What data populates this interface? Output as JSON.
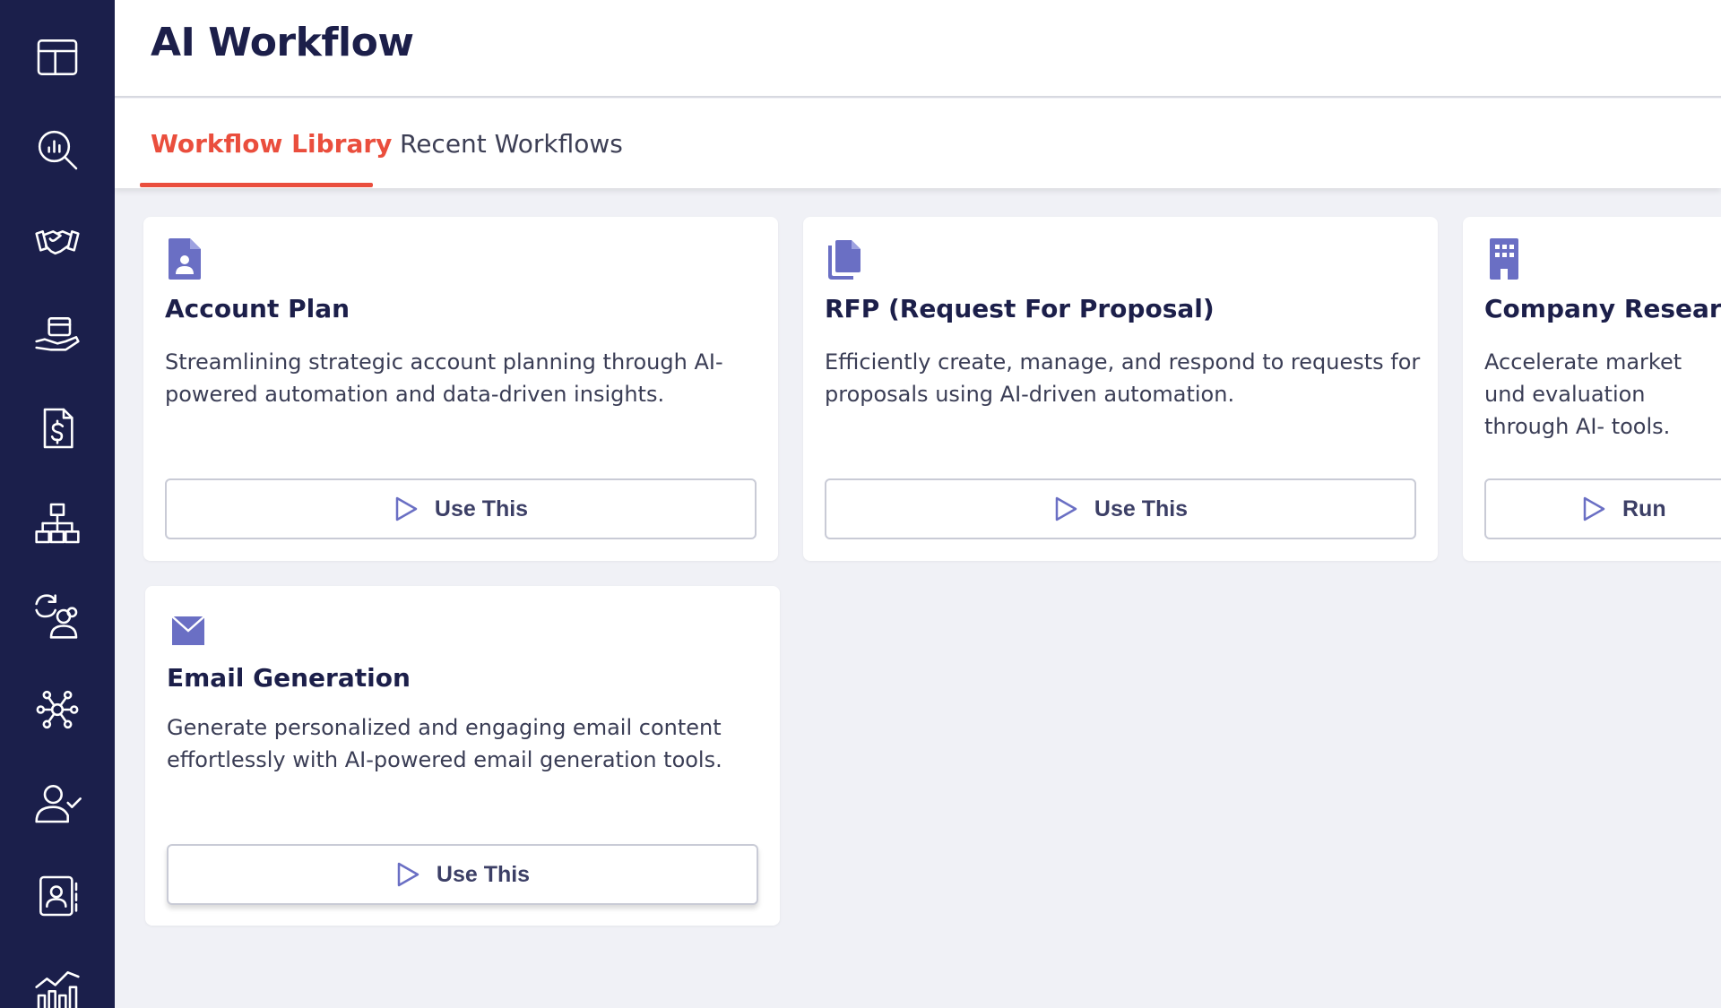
{
  "sidebar": {
    "items": [
      {
        "icon": "layout-icon"
      },
      {
        "icon": "analytics-search-icon"
      },
      {
        "icon": "handshake-icon"
      },
      {
        "icon": "hand-box-icon"
      },
      {
        "icon": "invoice-dollar-icon"
      },
      {
        "icon": "org-chart-icon"
      },
      {
        "icon": "user-sync-icon"
      },
      {
        "icon": "network-icon"
      },
      {
        "icon": "user-check-icon"
      },
      {
        "icon": "contact-book-icon"
      },
      {
        "icon": "chart-growth-icon"
      }
    ]
  },
  "header": {
    "title": "AI Workflow"
  },
  "tabs": [
    {
      "label": "Workflow Library",
      "active": true
    },
    {
      "label": "Recent Workflows",
      "active": false
    }
  ],
  "cards": [
    {
      "icon": "account-document-icon",
      "title": "Account Plan",
      "description": "Streamlining strategic account planning through AI-powered automation and data-driven insights.",
      "button": "Use This"
    },
    {
      "icon": "files-copy-icon",
      "title": "RFP (Request For Proposal)",
      "description": "Efficiently create, manage, and respond to requests for proposals using AI-driven automation.",
      "button": "Use This"
    },
    {
      "icon": "building-icon",
      "title": "Company Researc",
      "description": "Accelerate market und evaluation through AI- tools.",
      "button": "Run"
    },
    {
      "icon": "envelope-icon",
      "title": "Email Generation",
      "description": "Generate personalized and engaging email content effortlessly with AI-powered email generation tools.",
      "button": "Use This"
    }
  ],
  "colors": {
    "sidebar": "#1b1f4b",
    "accent": "#ea4e3d",
    "icon": "#6a6fc4",
    "background": "#f0f1f6"
  }
}
